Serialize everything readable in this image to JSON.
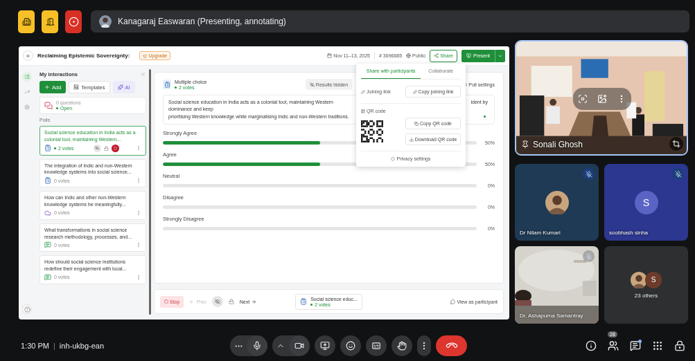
{
  "presenter_bar": {
    "name": "Kanagaraj Easwaran (Presenting, annotating)"
  },
  "shared_screen": {
    "header": {
      "title": "Reclaiming Epistemic Sovereignty:",
      "badge": "Upgrade",
      "dates": "Nov 11–13, 2025",
      "code": "# 3696685",
      "visibility": "Public",
      "share": "Share",
      "present": "Present"
    },
    "nav_rail": [
      {
        "kind": "list",
        "selected": true
      },
      {
        "kind": "trend",
        "selected": false
      },
      {
        "kind": "settings",
        "selected": false
      }
    ],
    "sidebar": {
      "title": "My interactions",
      "buttons": [
        {
          "kind": "add",
          "label": "Add"
        },
        {
          "kind": "templates",
          "label": "Templates"
        },
        {
          "kind": "ai",
          "label": "AI"
        }
      ],
      "qa_card": {
        "count": "0 questions",
        "status": "Open"
      },
      "polls_heading": "Polls",
      "polls": [
        {
          "kind": "choice",
          "text": "Social science education in India acts as a colonial tool, maintaining Western...",
          "votes": "2 votes",
          "selected": true,
          "live": true
        },
        {
          "kind": "choice",
          "text": "The integration of Indic and non-Western knowledge systems into social science...",
          "votes": "0 votes",
          "selected": false,
          "live": false
        },
        {
          "kind": "cloud",
          "text": "How can Indic and other non-Western knowledge systems be meaningfully...",
          "votes": "0 votes",
          "selected": false,
          "live": false
        },
        {
          "kind": "open",
          "text": "What transformations in social science research methodology, processes, and...",
          "votes": "0 votes",
          "selected": false,
          "live": false
        },
        {
          "kind": "open",
          "text": "How should social science institutions redefine their engagement with local...",
          "votes": "0 votes",
          "selected": false,
          "live": false
        }
      ]
    },
    "poll": {
      "type": "Multiple choice",
      "votes": "2 votes",
      "results_button": "Results hidden",
      "settings": "Poll settings",
      "question": {
        "line_1_left": "Social science education in India acts as a colonial tool, maintaining Western dominance and keep",
        "line_1_right": "ident by",
        "line_2": "prioritising Western knowledge while marginalising Indic and non-Western traditions."
      },
      "options": [
        {
          "label": "Strongly Agree",
          "level": 0.5,
          "percent": "50%"
        },
        {
          "label": "Agree",
          "level": 0.5,
          "percent": "50%"
        },
        {
          "label": "Neutral",
          "level": 0,
          "percent": "0%"
        },
        {
          "label": "Disagree",
          "level": 0,
          "percent": "0%"
        },
        {
          "label": "Strongly Disagree",
          "level": 0,
          "percent": "0%"
        }
      ]
    },
    "footer": {
      "stop": "Stop",
      "prev": "Prev",
      "prev_disabled": true,
      "next": "Next",
      "current": {
        "text": "Social science educ...",
        "votes": "2 votes"
      },
      "view": "View as participant"
    },
    "share_popover": {
      "tabs": [
        {
          "label": "Share with participants",
          "selected": true
        },
        {
          "label": "Collaborate",
          "selected": false
        }
      ],
      "link_label": "Joining link",
      "copy_link": "Copy joining link",
      "qr_label": "QR code",
      "copy_qr": "Copy QR code",
      "download_qr": "Download QR code",
      "privacy": "Privacy settings"
    }
  },
  "participants": [
    {
      "kind": "video",
      "name": "Sonali Ghosh",
      "speaking": true
    },
    {
      "name": "Dr Nilam Kumari",
      "muted": true,
      "color": "#1f3a55"
    },
    {
      "kind": "letter",
      "name": "soobhash sinha",
      "initial": "S",
      "muted": true,
      "color": "#2c3790"
    },
    {
      "kind": "camera",
      "name": "Dr. Ashapurna Samantray",
      "muted": true
    },
    {
      "kind": "others",
      "label": "23 others",
      "initial": "S",
      "color": "#2e2f31"
    }
  ],
  "bottom_bar": {
    "time": "1:30 PM",
    "separator": "|",
    "meeting_code": "inh-ukbg-ean",
    "people_count": "28",
    "chat_unread": true
  }
}
